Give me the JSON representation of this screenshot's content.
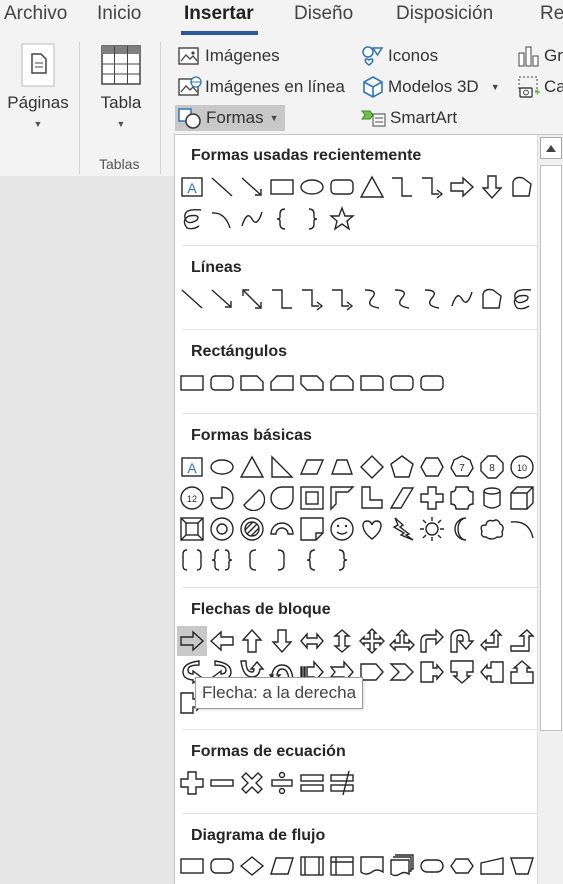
{
  "tabs": [
    "Archivo",
    "Inicio",
    "Insertar",
    "Diseño",
    "Disposición",
    "Re"
  ],
  "ribbon": {
    "paginas_label": "Páginas",
    "tabla_label": "Tabla",
    "tablas_group_label": "Tablas",
    "imagenes_label": "Imágenes",
    "imagenes_linea_label": "Imágenes en línea",
    "formas_label": "Formas",
    "iconos_label": "Iconos",
    "modelos3d_label": "Modelos 3D",
    "smartart_label": "SmartArt",
    "graficos_label": "Gr",
    "captura_label": "Ca"
  },
  "gallery": {
    "sections": [
      {
        "id": "recientes",
        "title": "Formas usadas recientemente"
      },
      {
        "id": "lineas",
        "title": "Líneas"
      },
      {
        "id": "rectangulos",
        "title": "Rectángulos"
      },
      {
        "id": "basicas",
        "title": "Formas básicas"
      },
      {
        "id": "flechas",
        "title": "Flechas de bloque"
      },
      {
        "id": "ecuacion",
        "title": "Formas de ecuación"
      },
      {
        "id": "flujo",
        "title": "Diagrama de flujo"
      }
    ],
    "tooltip": "Flecha: a la derecha"
  },
  "colors": {
    "accent": "#2b579a",
    "icon_blue": "#2e75b6",
    "hover": "#c9c9c9"
  }
}
